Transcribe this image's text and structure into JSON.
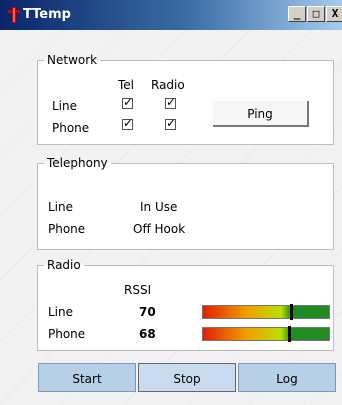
{
  "window": {
    "title": "TTemp",
    "min": "_",
    "max": "□",
    "close": "X"
  },
  "network": {
    "legend": "Network",
    "col_tel": "Tel",
    "col_radio": "Radio",
    "rows": [
      {
        "label": "Line",
        "tel_checked": true,
        "radio_checked": true
      },
      {
        "label": "Phone",
        "tel_checked": true,
        "radio_checked": true
      }
    ],
    "ping_label": "Ping"
  },
  "telephony": {
    "legend": "Telephony",
    "rows": [
      {
        "label": "Line",
        "status": "In Use"
      },
      {
        "label": "Phone",
        "status": "Off Hook"
      }
    ]
  },
  "radio": {
    "legend": "Radio",
    "col_rssi": "RSSI",
    "rows": [
      {
        "label": "Line",
        "rssi": "70",
        "level": 0.7
      },
      {
        "label": "Phone",
        "rssi": "68",
        "level": 0.68
      }
    ]
  },
  "buttons": {
    "start": "Start",
    "stop": "Stop",
    "log": "Log"
  }
}
